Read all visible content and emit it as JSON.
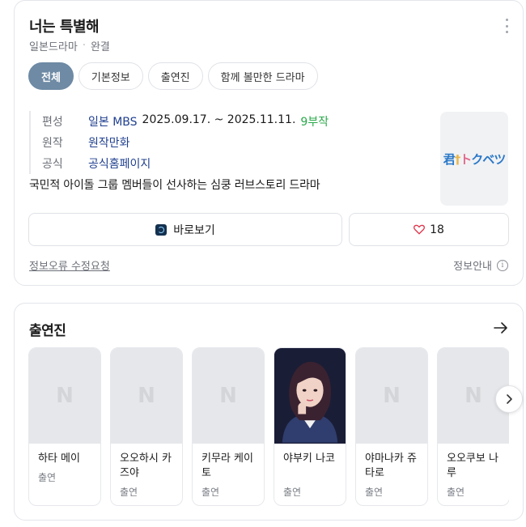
{
  "info": {
    "title": "너는 특별해",
    "genre": "일본드라마",
    "status": "완결",
    "tabs": [
      {
        "label": "전체",
        "active": true
      },
      {
        "label": "기본정보",
        "active": false
      },
      {
        "label": "출연진",
        "active": false
      },
      {
        "label": "함께 볼만한 드라마",
        "active": false
      }
    ],
    "meta": {
      "broadcast_label": "편성",
      "broadcast_network": "일본 MBS",
      "broadcast_period": "2025.09.17. ~ 2025.11.11.",
      "episodes": "9부작",
      "original_label": "원작",
      "original_value": "원작만화",
      "official_label": "공식",
      "official_value": "공식홈페이지"
    },
    "synopsis": "국민적 아이돌 그룹 멤버들이 선사하는 심쿵 러브스토리 드라마",
    "poster_logo": "君†トクベツ",
    "watch_label": "바로보기",
    "like_count": "18",
    "report_label": "정보오류 수정요청",
    "info_guide_label": "정보안내"
  },
  "cast": {
    "title": "출연진",
    "items": [
      {
        "name": "하타 메이",
        "role": "출연"
      },
      {
        "name": "오오하시 카즈야",
        "role": "출연"
      },
      {
        "name": "키무라 케이토",
        "role": "출연"
      },
      {
        "name": "야부키 나코",
        "role": "출연"
      },
      {
        "name": "야마나카 쥬타로",
        "role": "출연"
      },
      {
        "name": "오오쿠보 나루",
        "role": "출연"
      }
    ],
    "placeholder_logo": "N"
  },
  "colors": {
    "active_tab": "#6e8aa4",
    "link": "#1f3f8f",
    "episodes_green": "#2aa84a",
    "heart": "#e0344a"
  }
}
